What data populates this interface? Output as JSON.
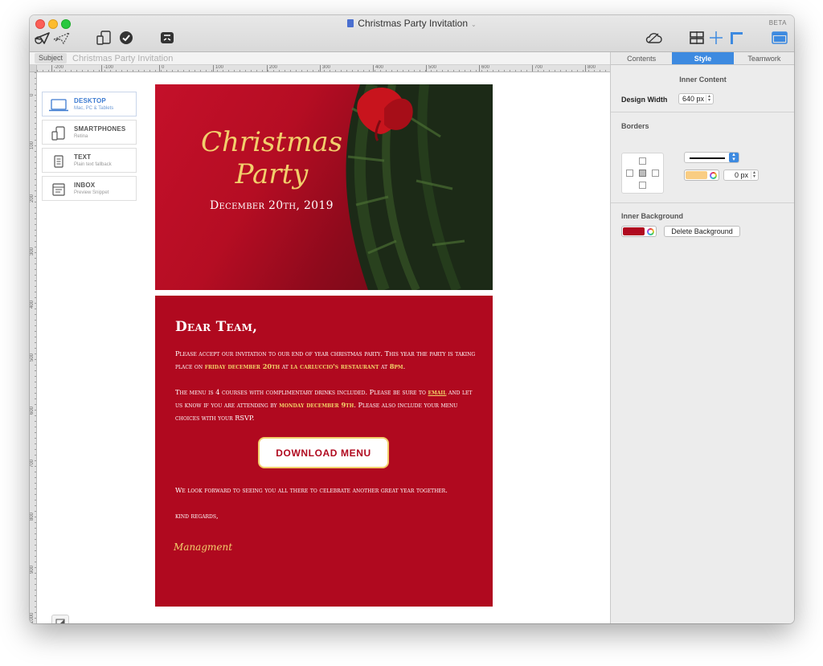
{
  "window": {
    "title": "Christmas Party Invitation",
    "badge": "BETA"
  },
  "subject": {
    "label": "Subject",
    "value": "Christmas Party Invitation"
  },
  "rulers": {
    "horizontal_labels": [
      "-200",
      "-100",
      "0",
      "100",
      "200",
      "300",
      "400",
      "500",
      "600",
      "700",
      "800"
    ],
    "vertical_labels": [
      "0",
      "100",
      "200",
      "300",
      "400",
      "500",
      "600",
      "700",
      "800",
      "900",
      "1000"
    ]
  },
  "devices": [
    {
      "title": "DESKTOP",
      "subtitle": "Mac, PC & Tablets",
      "icon": "laptop-icon"
    },
    {
      "title": "SMARTPHONES",
      "subtitle": "Retina",
      "icon": "smartphone-icon"
    },
    {
      "title": "TEXT",
      "subtitle": "Plain text fallback",
      "icon": "text-document-icon"
    },
    {
      "title": "INBOX",
      "subtitle": "Preview Snippet",
      "icon": "inbox-preview-icon"
    }
  ],
  "email": {
    "hero_title": "Christmas Party",
    "hero_date": "December 20th, 2019",
    "greeting": "Dear Team,",
    "p1_a": "Please accept our invitation to our end of year christmas party. This year the party is taking place on ",
    "p1_hl1": "friday december 20th",
    "p1_b": " at ",
    "p1_hl2": "la carluccio's restaurant",
    "p1_c": " at ",
    "p1_hl3": "8pm",
    "p1_d": ".",
    "p2_a": "The menu is 4 courses with complimentary drinks included. Please be sure to ",
    "p2_link": "email",
    "p2_b": " and let us know if you are attending by ",
    "p2_hl": "monday december 9th",
    "p2_c": ".  Please also include your menu choices with your RSVP.",
    "button": "DOWNLOAD MENU",
    "closing": "We look forward to seeing you all there to celebrate another great year together.",
    "regards": "kind regards,",
    "signature": "Managment"
  },
  "inspector": {
    "tabs": [
      "Contents",
      "Style",
      "Teamwork"
    ],
    "active_tab": "Style",
    "inner_content_heading": "Inner Content",
    "design_width_label": "Design Width",
    "design_width_value": "640 px",
    "borders_heading": "Borders",
    "border_width_value": "0 px",
    "border_color": "#f9cd83",
    "inner_background_heading": "Inner Background",
    "inner_background_color": "#b0091f",
    "delete_background_label": "Delete Background"
  },
  "colors": {
    "accent": "#3d8ae0",
    "email_red": "#b0091f",
    "gold": "#f2cf6c"
  }
}
